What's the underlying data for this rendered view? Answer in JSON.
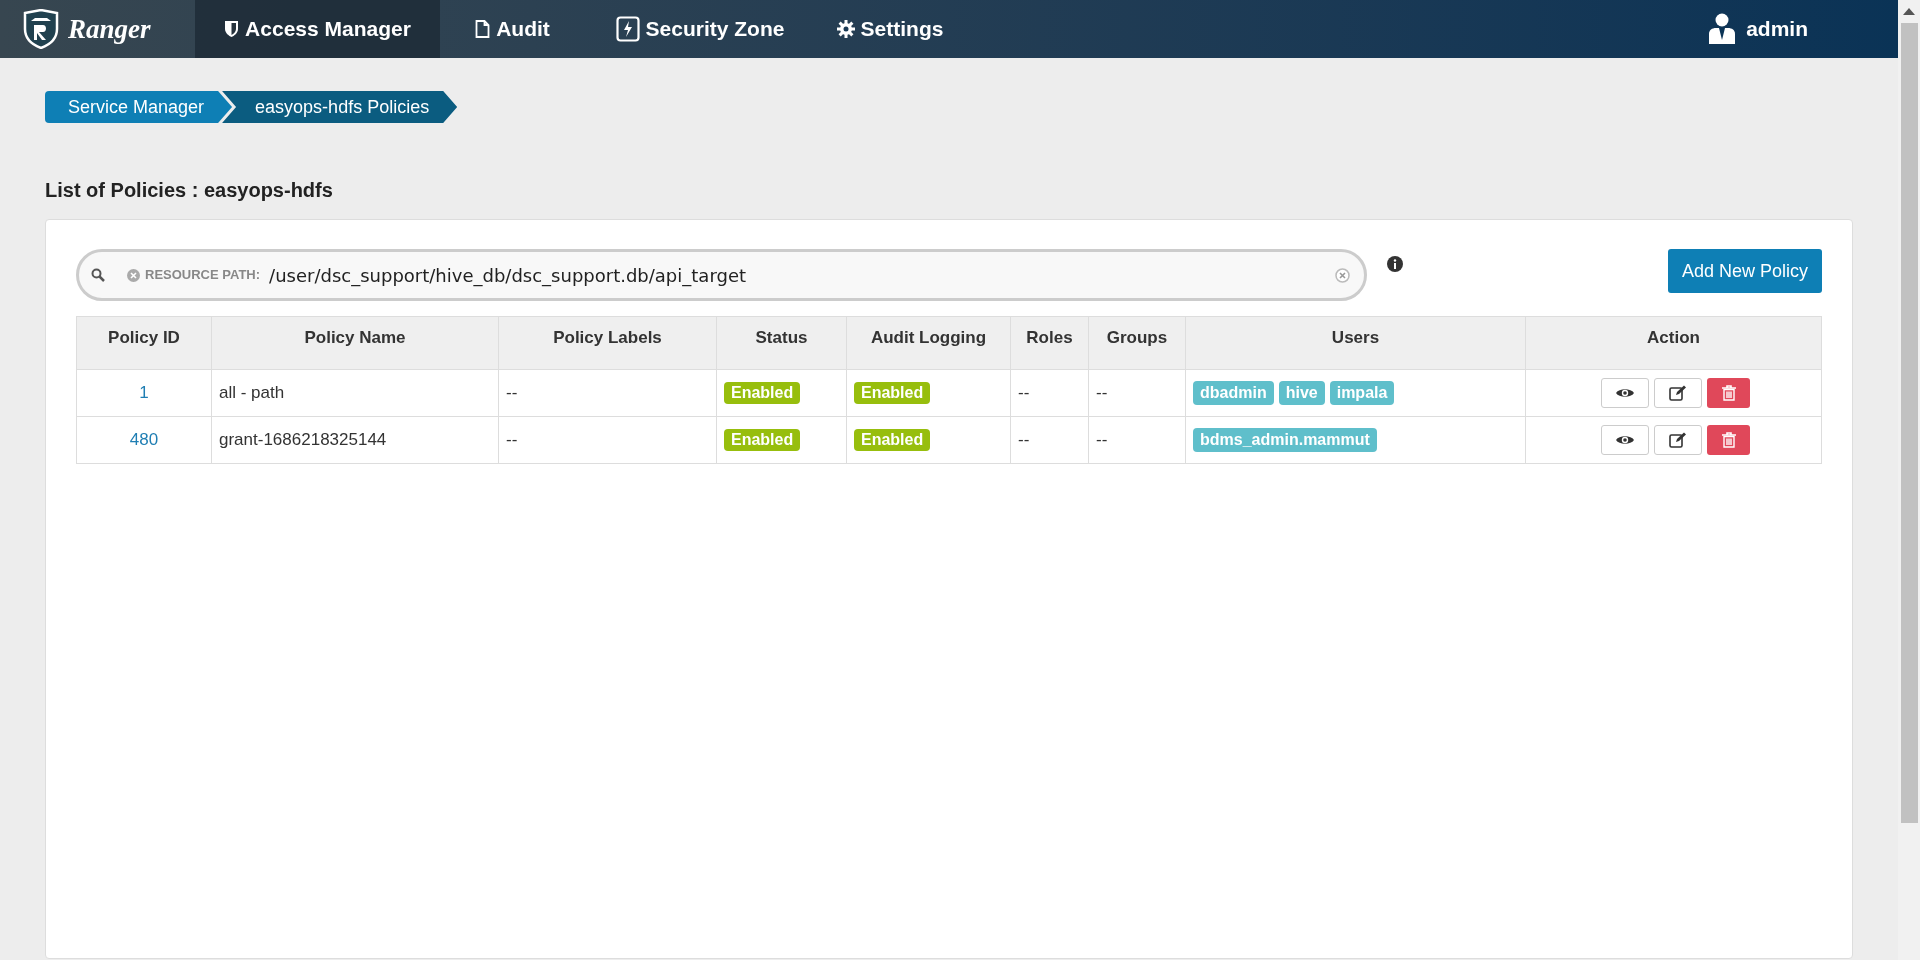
{
  "navbar": {
    "brand": "Ranger",
    "items": [
      {
        "label": "Access Manager",
        "selected": true
      },
      {
        "label": "Audit",
        "selected": false
      },
      {
        "label": "Security Zone",
        "selected": false
      },
      {
        "label": "Settings",
        "selected": false
      }
    ],
    "user": "admin"
  },
  "breadcrumbs": [
    {
      "label": "Service Manager",
      "selected": false
    },
    {
      "label": "easyops-hdfs Policies",
      "selected": true
    }
  ],
  "title": "List of Policies : easyops-hdfs",
  "search": {
    "token_label": "RESOURCE PATH:",
    "token_value": "/user/dsc_support/hive_db/dsc_support.db/api_target"
  },
  "add_button": "Add New Policy",
  "table": {
    "columns": [
      "Policy ID",
      "Policy Name",
      "Policy Labels",
      "Status",
      "Audit Logging",
      "Roles",
      "Groups",
      "Users",
      "Action"
    ],
    "rows": [
      {
        "id": "1",
        "name": "all - path",
        "labels": "--",
        "status": "Enabled",
        "audit": "Enabled",
        "roles": "--",
        "groups": "--",
        "users": [
          "dbadmin",
          "hive",
          "impala"
        ]
      },
      {
        "id": "480",
        "name": "grant-1686218325144",
        "labels": "--",
        "status": "Enabled",
        "audit": "Enabled",
        "roles": "--",
        "groups": "--",
        "users": [
          "bdms_admin.mammut"
        ]
      }
    ]
  }
}
